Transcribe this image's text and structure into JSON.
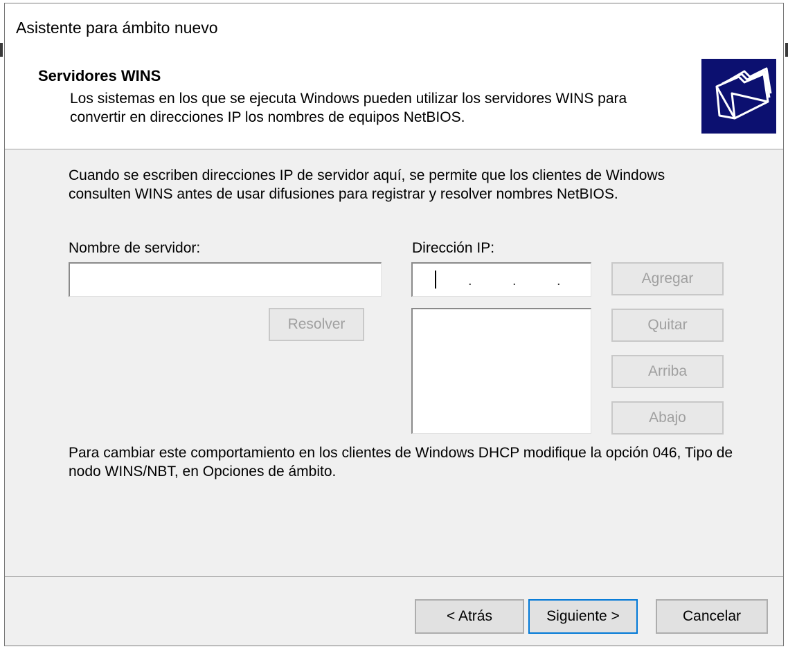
{
  "window": {
    "title": "Asistente para ámbito nuevo"
  },
  "header": {
    "title": "Servidores WINS",
    "description": "Los sistemas en los que se ejecuta Windows pueden utilizar los servidores WINS para convertir en direcciones IP los nombres de equipos NetBIOS.",
    "icon": "folders-icon"
  },
  "content": {
    "intro": "Cuando se escriben direcciones IP de servidor aquí, se permite que los clientes de Windows consulten WINS antes de usar difusiones para registrar y resolver nombres NetBIOS.",
    "server_name_label": "Nombre de servidor:",
    "server_name_value": "",
    "ip_label": "Dirección IP:",
    "ip_dot": ".",
    "resolve_button": "Resolver",
    "add_button": "Agregar",
    "remove_button": "Quitar",
    "up_button": "Arriba",
    "down_button": "Abajo",
    "note": "Para cambiar este comportamiento en los clientes de Windows DHCP modifique la opción 046, Tipo de nodo WINS/NBT, en Opciones de ámbito."
  },
  "footer": {
    "back_button": "< Atrás",
    "next_button": "Siguiente >",
    "cancel_button": "Cancelar"
  },
  "colors": {
    "icon_background": "#0c1070",
    "focus_border": "#0078d7",
    "dialog_background": "#f0f0f0"
  }
}
